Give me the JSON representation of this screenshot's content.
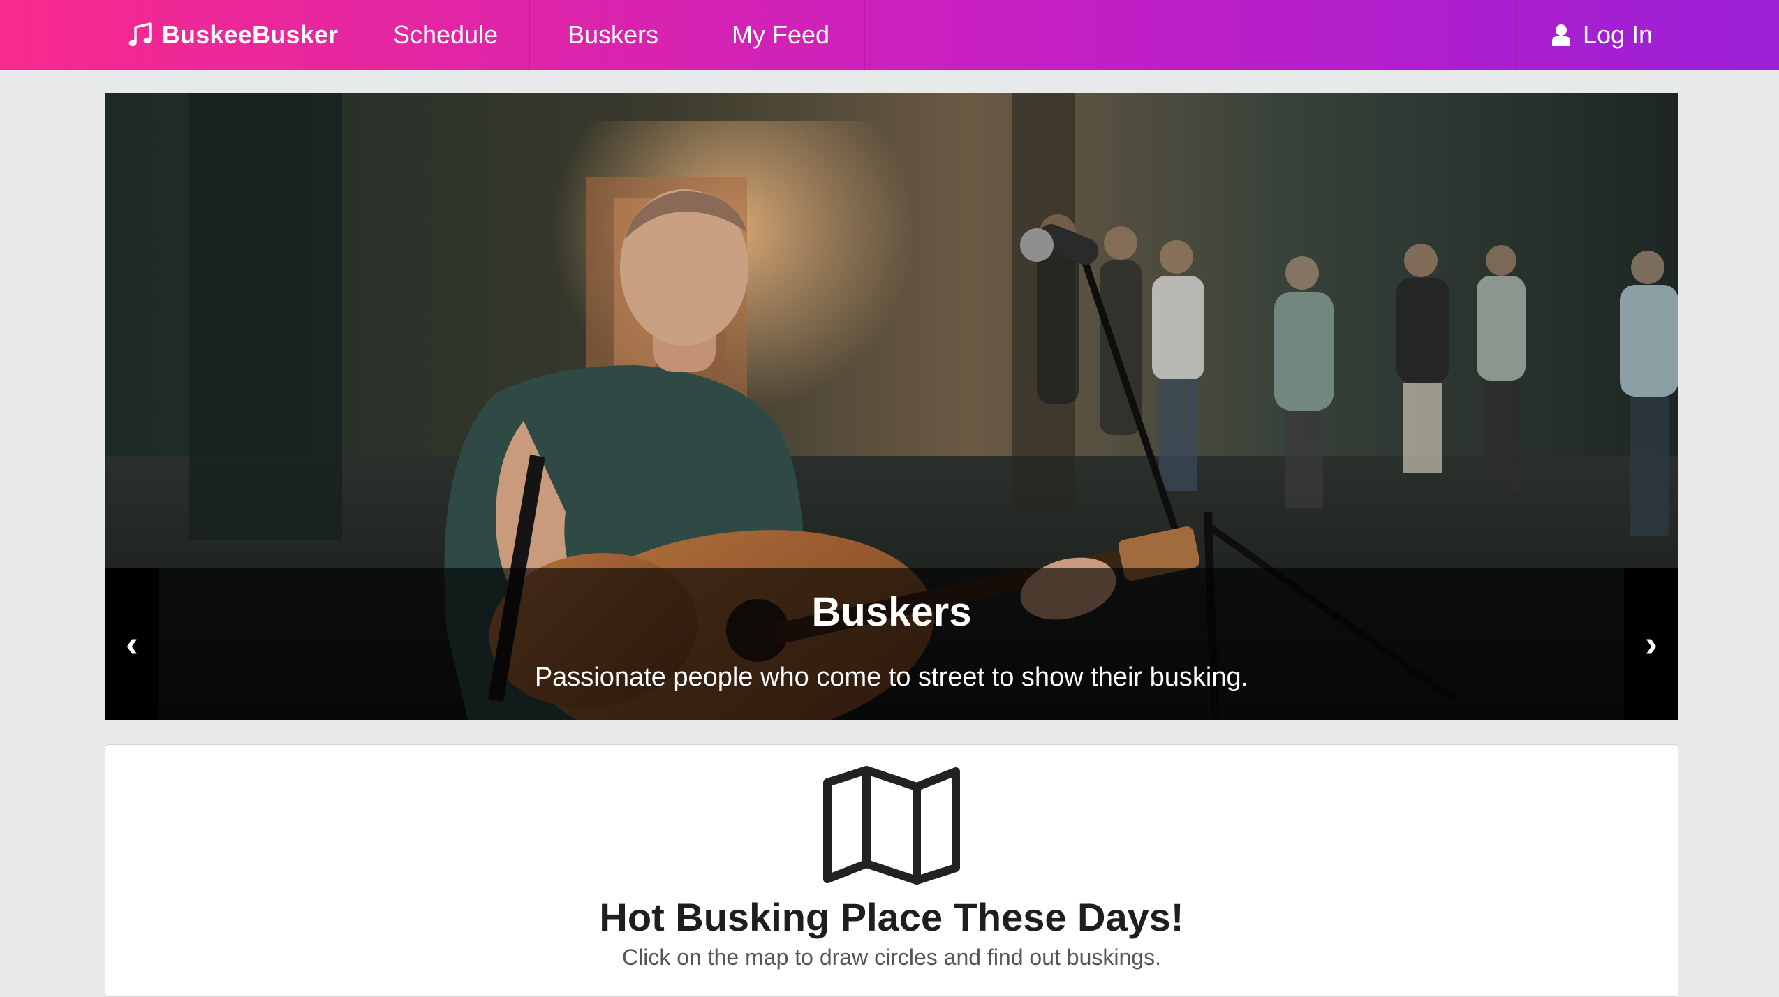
{
  "navbar": {
    "brand": {
      "icon": "music-note-icon",
      "label": "BuskeeBusker"
    },
    "items": [
      {
        "label": "Schedule"
      },
      {
        "label": "Buskers"
      },
      {
        "label": "My Feed"
      }
    ],
    "login": {
      "icon": "user-icon",
      "label": "Log In"
    },
    "colors": {
      "gradient_start": "#f82a8d",
      "gradient_mid": "#c81fc1",
      "gradient_end": "#9b1fd6"
    }
  },
  "carousel": {
    "slide": {
      "title": "Buskers",
      "caption": "Passionate people who come to street to show their busking."
    },
    "prev_label": "‹",
    "next_label": "›",
    "prev_icon": "chevron-left-icon",
    "next_icon": "chevron-right-icon"
  },
  "map_card": {
    "icon": "map-icon",
    "title": "Hot Busking Place These Days!",
    "subtitle": "Click on the map to draw circles and find out buskings."
  }
}
